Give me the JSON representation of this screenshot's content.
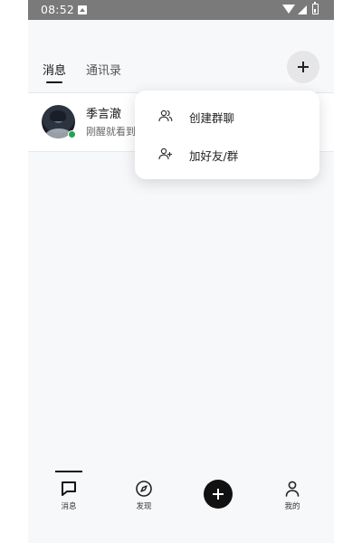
{
  "status_bar": {
    "time": "08:52"
  },
  "header": {
    "tabs": [
      {
        "label": "消息",
        "active": true
      },
      {
        "label": "通讯录",
        "active": false
      }
    ]
  },
  "conversations": [
    {
      "name": "季言澈",
      "preview": "刚醒就看到",
      "online": true
    }
  ],
  "dropdown": {
    "items": [
      {
        "label": "创建群聊",
        "icon": "group-icon"
      },
      {
        "label": "加好友/群",
        "icon": "add-friend-icon"
      }
    ]
  },
  "bottom_nav": {
    "items": [
      {
        "label": "消息",
        "icon": "chat-bubble-icon",
        "active": true
      },
      {
        "label": "发现",
        "icon": "compass-icon",
        "active": false
      },
      {
        "label": "",
        "icon": "plus-icon",
        "active": false
      },
      {
        "label": "我的",
        "icon": "person-icon",
        "active": false
      }
    ]
  },
  "colors": {
    "accent": "#111111",
    "online": "#22a455",
    "status_bar": "#7a7a7a",
    "background": "#f7f8fa"
  }
}
